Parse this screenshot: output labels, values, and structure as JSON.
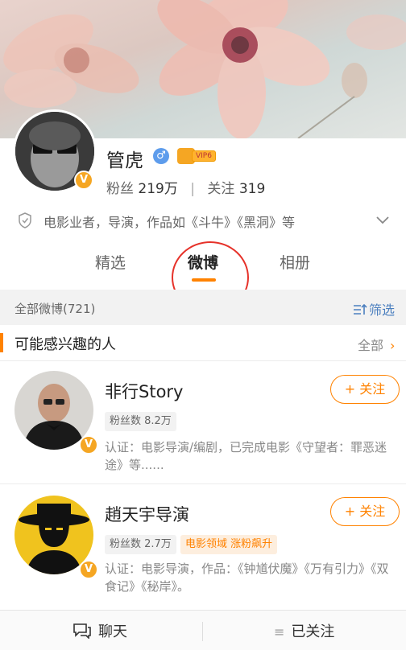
{
  "profile": {
    "name": "管虎",
    "gender_symbol": "♂",
    "vip_label": "VIP6",
    "fans_label": "粉丝",
    "fans_value": "219万",
    "following_label": "关注",
    "following_value": "319",
    "bio": "电影业者，导演，作品如《斗牛》《黑洞》等"
  },
  "tabs": [
    {
      "label": "精选",
      "active": false
    },
    {
      "label": "微博",
      "active": true
    },
    {
      "label": "相册",
      "active": false
    }
  ],
  "feed_header": {
    "all_label": "全部微博(721)",
    "filter_label": "筛选"
  },
  "interest": {
    "title": "可能感兴趣的人",
    "all_label": "全部"
  },
  "users": [
    {
      "name": "非行Story",
      "follow_label": "+ 关注",
      "fans": "粉丝数 8.2万",
      "cert": "认证：电影导演/编剧，已完成电影《守望者：罪恶迷途》等......"
    },
    {
      "name": "趙天宇导演",
      "follow_label": "+ 关注",
      "fans": "粉丝数 2.7万",
      "tag": "电影领域 涨粉飙升",
      "cert": "认证：电影导演，作品：《钟馗伏魔》《万有引力》《双食记》《秘岸》。"
    }
  ],
  "bottom_bar": {
    "chat_label": "聊天",
    "followed_label": "已关注"
  },
  "colors": {
    "accent": "#ff8200",
    "link_blue": "#4b7fbf",
    "verified": "#f5a623",
    "annotation_circle": "#e6322a"
  },
  "icons": [
    "shield-icon",
    "chevron-down-icon",
    "filter-icon",
    "chevron-right-icon",
    "chat-icon",
    "menu-lines-icon",
    "verified-v-icon",
    "male-icon",
    "vip-crown-icon"
  ]
}
